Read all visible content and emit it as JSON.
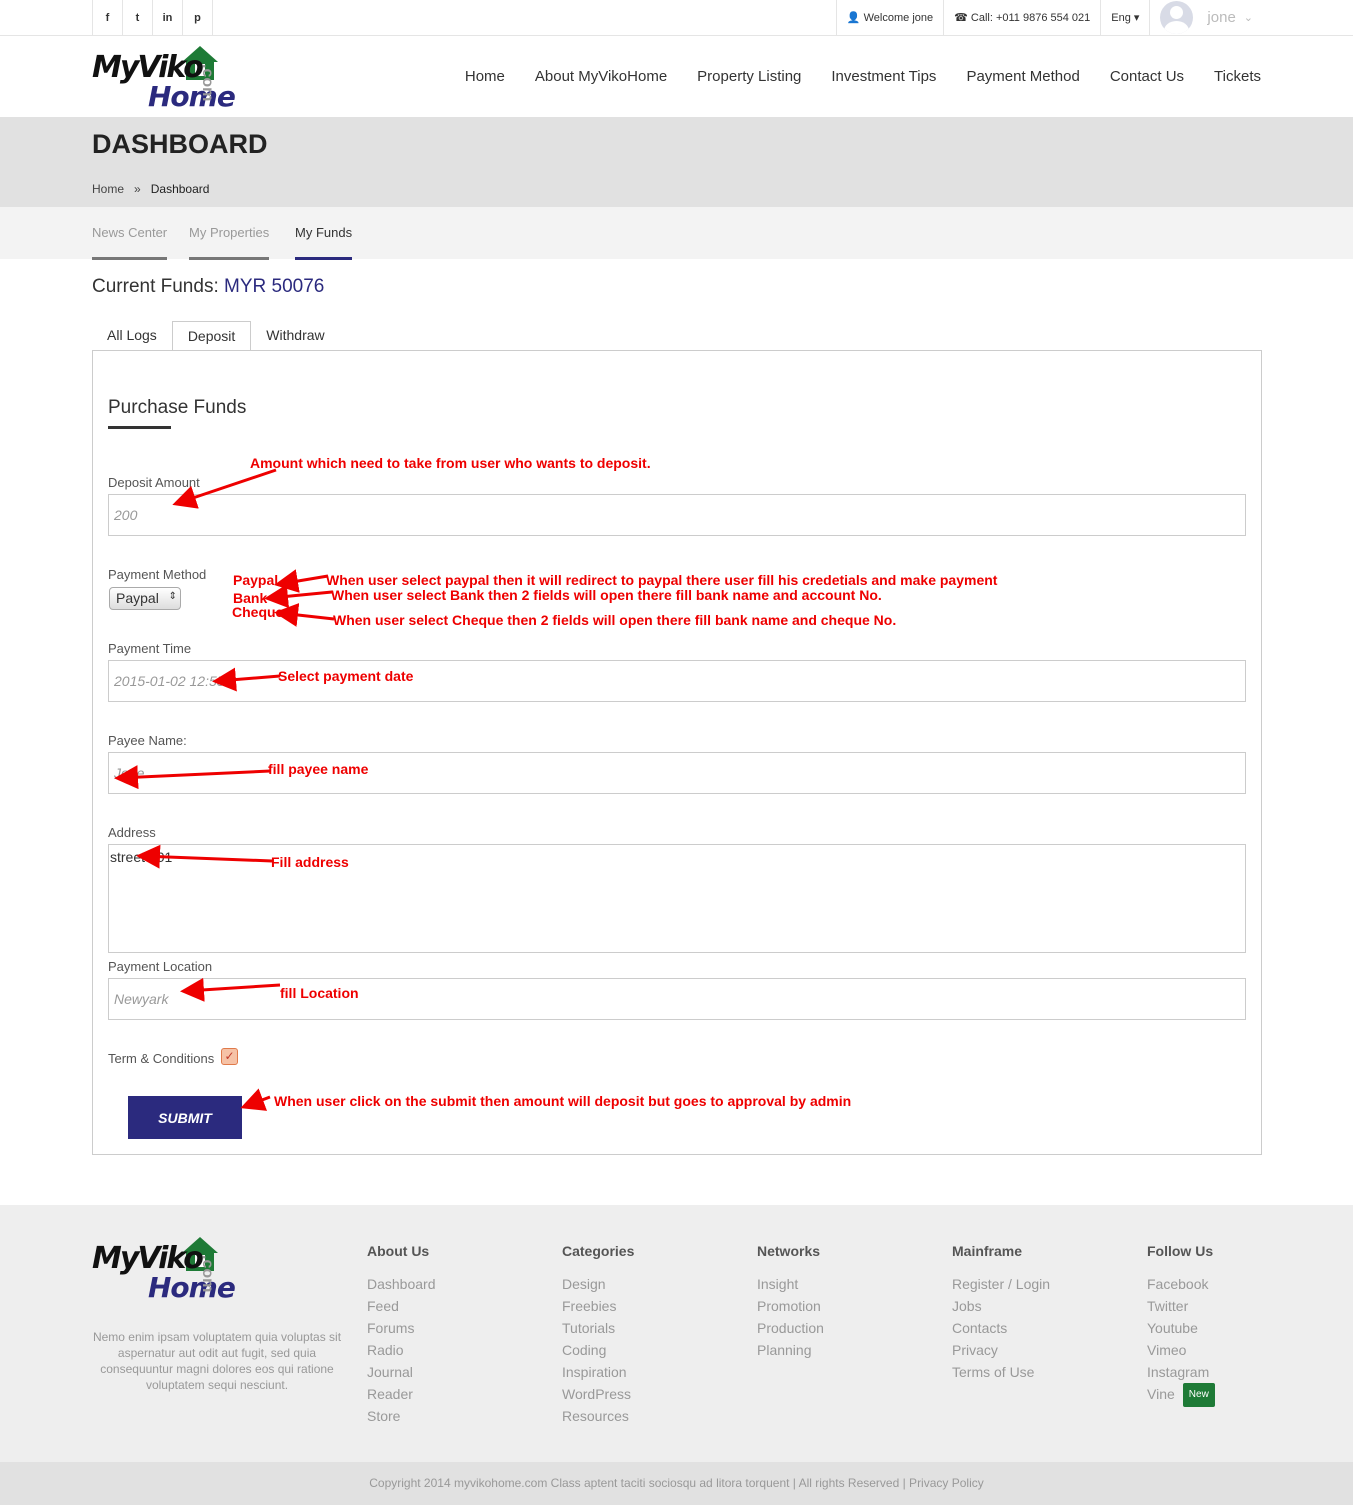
{
  "topbar": {
    "social": [
      "f",
      "t",
      "in",
      "p"
    ],
    "welcome": "Welcome jone",
    "call": "Call: +011 9876 554 021",
    "lang": "Eng",
    "user": "jone"
  },
  "logo": {
    "my": "MyViko",
    "home": "Home",
    "com": ".com"
  },
  "nav": [
    "Home",
    "About MyVikoHome",
    "Property Listing",
    "Investment Tips",
    "Payment Method",
    "Contact Us",
    "Tickets"
  ],
  "page": {
    "title": "DASHBOARD",
    "breadcrumb_home": "Home",
    "breadcrumb_sep": "»",
    "breadcrumb_current": "Dashboard"
  },
  "subnav": [
    "News Center",
    "My Properties",
    "My Funds"
  ],
  "funds": {
    "label": "Current Funds:",
    "value": "MYR 50076"
  },
  "tabs": [
    "All Logs",
    "Deposit",
    "Withdraw"
  ],
  "form": {
    "title": "Purchase Funds",
    "deposit_label": "Deposit Amount",
    "deposit_value": "200",
    "method_label": "Payment Method",
    "method_value": "Paypal",
    "time_label": "Payment Time",
    "time_value": "2015-01-02 12:55",
    "payee_label": "Payee Name:",
    "payee_value": "Jone",
    "address_label": "Address",
    "address_value": "street 201",
    "location_label": "Payment Location",
    "location_value": "Newyark",
    "terms_label": "Term & Conditions",
    "submit": "SUBMIT"
  },
  "notes": {
    "deposit": "Amount which need to take from user who wants to deposit.",
    "paypal_word": "Paypal",
    "bank_word": "Bank",
    "cheque_word": "Cheque",
    "paypal": "When user select paypal then it will redirect to paypal there user fill his credetials and make payment",
    "bank": "When user select Bank then 2 fields will open there fill bank name and account No.",
    "cheque": "When user select Cheque then 2 fields will open there fill bank name and cheque No.",
    "time": "Select payment date",
    "payee": "fill payee name",
    "address": "Fill address",
    "location": "fill Location",
    "submit": "When user click on the submit then amount will deposit but goes to approval by admin"
  },
  "footer": {
    "description": "Nemo enim ipsam voluptatem quia voluptas sit aspernatur aut odit aut fugit, sed quia consequuntur magni dolores eos qui ratione voluptatem sequi nesciunt.",
    "columns": [
      {
        "title": "About Us",
        "items": [
          "Dashboard",
          "Feed",
          "Forums",
          "Radio",
          "Journal",
          "Reader",
          "Store"
        ]
      },
      {
        "title": "Categories",
        "items": [
          "Design",
          "Freebies",
          "Tutorials",
          "Coding",
          "Inspiration",
          "WordPress",
          "Resources"
        ]
      },
      {
        "title": "Networks",
        "items": [
          "Insight",
          "Promotion",
          "Production",
          "Planning"
        ]
      },
      {
        "title": "Mainframe",
        "items": [
          "Register / Login",
          "Jobs",
          "Contacts",
          "Privacy",
          "Terms of Use"
        ]
      },
      {
        "title": "Follow Us",
        "items": [
          "Facebook",
          "Twitter",
          "Youtube",
          "Vimeo",
          "Instagram",
          "Vine"
        ]
      }
    ],
    "new_badge": "New",
    "copyright": "Copyright 2014 myvikohome.com Class aptent taciti sociosqu ad litora torquent | All rights Reserved | Privacy Policy"
  },
  "colors": {
    "brand": "#2b2a7e",
    "annotation": "#ee0000",
    "logo_green": "#1e7a36"
  }
}
